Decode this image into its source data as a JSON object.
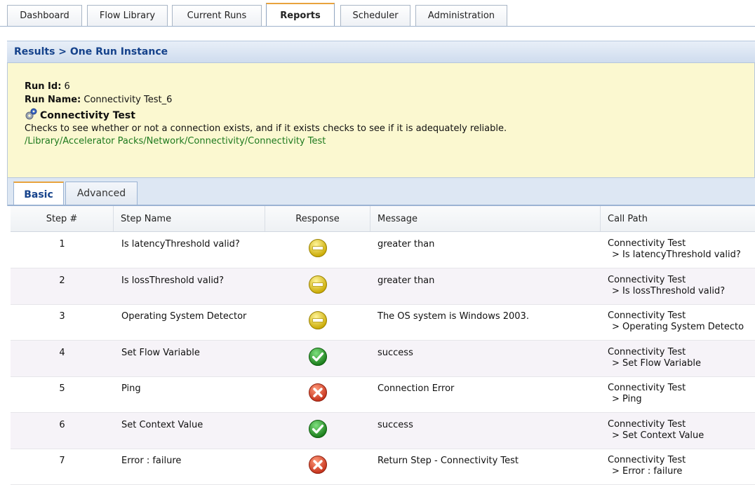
{
  "top_tabs": [
    "Dashboard",
    "Flow Library",
    "Current Runs",
    "Reports",
    "Scheduler",
    "Administration"
  ],
  "active_top_tab": "Reports",
  "breadcrumb": "Results > One Run Instance",
  "run": {
    "id_label": "Run Id:",
    "id_value": " 6",
    "name_label": "Run Name:",
    "name_value": " Connectivity Test_6",
    "flow_title": "Connectivity Test",
    "description": "Checks to see whether or not a connection exists, and if it exists checks to see if it is adequately reliable.",
    "path": "/Library/Accelerator Packs/Network/Connectivity/Connectivity Test"
  },
  "sub_tabs": [
    "Basic",
    "Advanced"
  ],
  "active_sub_tab": "Basic",
  "columns": [
    "Step #",
    "Step Name",
    "Response",
    "Message",
    "Call Path"
  ],
  "rows": [
    {
      "step": "1",
      "name": "Is latencyThreshold valid?",
      "response": "neutral-icon",
      "message": "greater than",
      "call_path_1": "Connectivity Test",
      "call_path_2": "> Is latencyThreshold valid?"
    },
    {
      "step": "2",
      "name": "Is lossThreshold valid?",
      "response": "neutral-icon",
      "message": "greater than",
      "call_path_1": "Connectivity Test",
      "call_path_2": "> Is lossThreshold valid?"
    },
    {
      "step": "3",
      "name": "Operating System Detector",
      "response": "neutral-icon",
      "message": "The OS system is Windows 2003.",
      "call_path_1": "Connectivity Test",
      "call_path_2": "> Operating System Detecto"
    },
    {
      "step": "4",
      "name": "Set Flow Variable",
      "response": "success-icon",
      "message": "success",
      "call_path_1": "Connectivity Test",
      "call_path_2": "> Set Flow Variable"
    },
    {
      "step": "5",
      "name": "Ping",
      "response": "failure-icon",
      "message": "Connection Error",
      "call_path_1": "Connectivity Test",
      "call_path_2": "> Ping"
    },
    {
      "step": "6",
      "name": "Set Context Value",
      "response": "success-icon",
      "message": "success",
      "call_path_1": "Connectivity Test",
      "call_path_2": "> Set Context Value"
    },
    {
      "step": "7",
      "name": "Error : failure",
      "response": "failure-icon",
      "message": "Return Step - Connectivity Test",
      "call_path_1": "Connectivity Test",
      "call_path_2": "> Error : failure"
    }
  ],
  "colors": {
    "breadcrumb": "#15428b",
    "info_bg": "#fbf8d0",
    "path": "#1e7a1e",
    "active_tab_accent": "#e8a33d"
  }
}
